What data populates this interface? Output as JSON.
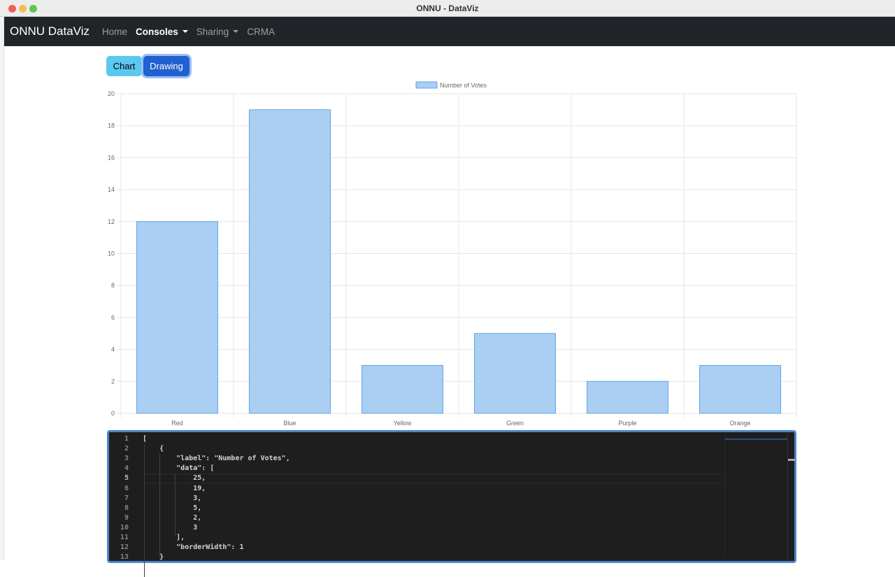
{
  "window": {
    "title": "ONNU - DataViz"
  },
  "navbar": {
    "brand": "ONNU DataViz",
    "items": [
      {
        "label": "Home"
      },
      {
        "label": "Consoles",
        "dropdown": true,
        "active": true
      },
      {
        "label": "Sharing",
        "dropdown": true
      },
      {
        "label": "CRMA"
      }
    ]
  },
  "toggle": {
    "chart_label": "Chart",
    "drawing_label": "Drawing",
    "selected": "Drawing"
  },
  "colors": {
    "bar_fill": "#aacff2",
    "bar_border": "#5fa3e6",
    "chart_button": "#5bc8ef",
    "drawing_button": "#2160d0"
  },
  "chart_data": {
    "type": "bar",
    "categories": [
      "Red",
      "Blue",
      "Yellow",
      "Green",
      "Purple",
      "Orange"
    ],
    "series": [
      {
        "name": "Number of Votes",
        "values": [
          12,
          19,
          3,
          5,
          2,
          3
        ]
      }
    ],
    "ylim": [
      0,
      20
    ],
    "yticks": [
      "0",
      "2",
      "4",
      "6",
      "8",
      "10",
      "12",
      "14",
      "16",
      "18",
      "20"
    ],
    "grid": true,
    "legend": "top"
  },
  "editor": {
    "active_line": 5,
    "lines": [
      "[",
      "    {",
      "        \"label\": \"Number of Votes\",",
      "        \"data\": [",
      "            25,",
      "            19,",
      "            3,",
      "            5,",
      "            2,",
      "            3",
      "        ],",
      "        \"borderWidth\": 1",
      "    }"
    ]
  }
}
